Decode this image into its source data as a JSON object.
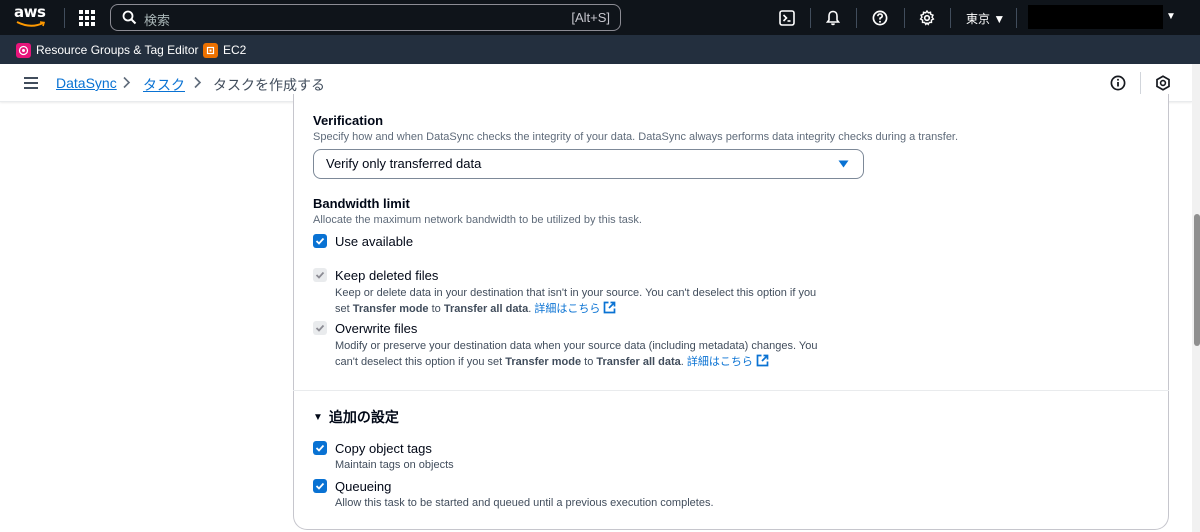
{
  "topnav": {
    "logo_text": "aws",
    "search_placeholder": "検索",
    "search_shortcut": "[Alt+S]",
    "region": "東京 ▼"
  },
  "favorites": [
    {
      "label": "Resource Groups & Tag Editor",
      "color": "#e7157b"
    },
    {
      "label": "EC2",
      "color": "#ed7100"
    }
  ],
  "breadcrumb": {
    "items": [
      "DataSync",
      "タスク"
    ],
    "current": "タスクを作成する"
  },
  "verification": {
    "label": "Verification",
    "description": "Specify how and when DataSync checks the integrity of your data. DataSync always performs data integrity checks during a transfer.",
    "selected": "Verify only transferred data"
  },
  "bandwidth": {
    "label": "Bandwidth limit",
    "description": "Allocate the maximum network bandwidth to be utilized by this task.",
    "use_available_label": "Use available"
  },
  "keep_deleted": {
    "label": "Keep deleted files",
    "desc_line1": "Keep or delete data in your destination that isn't in your source. You can't deselect this option if you",
    "desc_pre": "set ",
    "desc_b1": "Transfer mode",
    "desc_mid": " to ",
    "desc_b2": "Transfer all data",
    "desc_post": ". ",
    "learn_more": "詳細はこちら"
  },
  "overwrite": {
    "label": "Overwrite files",
    "desc_line1": "Modify or preserve your destination data when your source data (including metadata) changes. You",
    "desc_pre": "can't deselect this option if you set ",
    "desc_b1": "Transfer mode",
    "desc_mid": " to ",
    "desc_b2": "Transfer all data",
    "desc_post": ". ",
    "learn_more": "詳細はこちら"
  },
  "additional": {
    "title": "追加の設定",
    "copy_tags_label": "Copy object tags",
    "copy_tags_desc": "Maintain tags on objects",
    "queueing_label": "Queueing",
    "queueing_desc": "Allow this task to be started and queued until a previous execution completes."
  }
}
